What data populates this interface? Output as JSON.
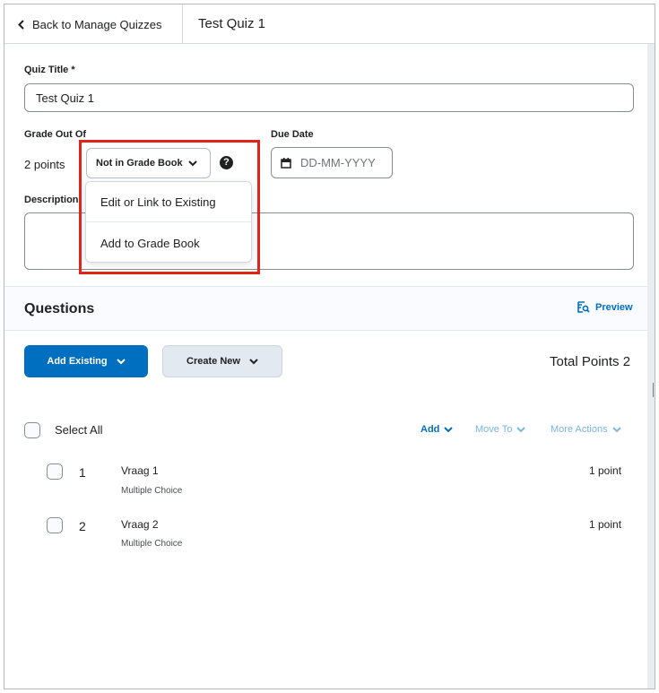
{
  "header": {
    "back_label": "Back to Manage Quizzes",
    "page_title": "Test Quiz 1"
  },
  "form": {
    "title_label": "Quiz Title *",
    "title_value": "Test Quiz 1",
    "grade_label": "Grade Out Of",
    "points_value": "2 points",
    "grade_select_value": "Not in Grade Book",
    "due_date_label": "Due Date",
    "due_date_placeholder": "DD-MM-YYYY",
    "description_label": "Description",
    "description_value": ""
  },
  "grade_menu": {
    "items": [
      {
        "label": "Edit or Link to Existing"
      },
      {
        "label": "Add to Grade Book"
      }
    ]
  },
  "questions": {
    "heading": "Questions",
    "preview_label": "Preview",
    "add_existing_label": "Add Existing",
    "create_new_label": "Create New",
    "total_points": "Total Points 2",
    "select_all_label": "Select All",
    "actions": {
      "add": "Add",
      "move_to": "Move To",
      "more_actions": "More Actions"
    },
    "items": [
      {
        "number": "1",
        "title": "Vraag 1",
        "type": "Multiple Choice",
        "points": "1 point"
      },
      {
        "number": "2",
        "title": "Vraag 2",
        "type": "Multiple Choice",
        "points": "1 point"
      }
    ]
  },
  "colors": {
    "accent": "#006fbf",
    "highlight": "#e2231a",
    "secondary_button": "#e3e9f1"
  }
}
